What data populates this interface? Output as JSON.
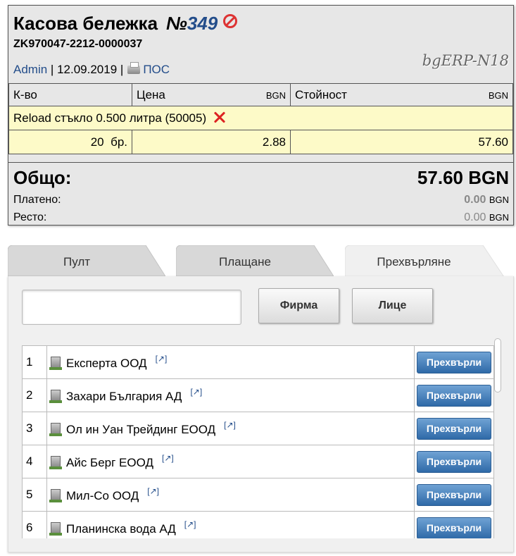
{
  "receipt": {
    "title": "Касова бележка",
    "number_prefix": "№",
    "number": "349",
    "code": "ZK970047-2212-0000037",
    "user": "Admin",
    "separator": "|",
    "date": "12.09.2019",
    "pos_link": "ПОС",
    "brand": "bgERP-N18",
    "columns": {
      "qty": "К-во",
      "price": "Цена",
      "price_currency": "BGN",
      "amount": "Стойност",
      "amount_currency": "BGN"
    },
    "line": {
      "product": "Reload стъкло 0.500 литра (50005)",
      "qty": "20",
      "unit": "бр.",
      "price": "2.88",
      "amount": "57.60"
    },
    "total_label": "Общо:",
    "total_value": "57.60 BGN",
    "paid_label": "Платено:",
    "paid_value": "0.00",
    "paid_currency": "BGN",
    "change_label": "Ресто:",
    "change_value": "0.00",
    "change_currency": "BGN"
  },
  "tabs": [
    {
      "label": "Пулт",
      "active": false
    },
    {
      "label": "Плащане",
      "active": false
    },
    {
      "label": "Прехвърляне",
      "active": true
    }
  ],
  "transfer": {
    "search_value": "",
    "btn_company": "Фирма",
    "btn_person": "Лице",
    "action_label": "Прехвърли",
    "rows": [
      {
        "idx": "1",
        "name": "Експерта ООД"
      },
      {
        "idx": "2",
        "name": "Захари България АД"
      },
      {
        "idx": "3",
        "name": "Ол ин Уан Трейдинг ЕООД"
      },
      {
        "idx": "4",
        "name": "Айс Берг ЕООД"
      },
      {
        "idx": "5",
        "name": "Мил-Со ООД"
      },
      {
        "idx": "6",
        "name": "Планинска вода АД"
      }
    ]
  },
  "colors": {
    "accent": "#234d8a",
    "row_highlight": "#fdfac8",
    "button_blue": "#3b78b8",
    "delete_red": "#d22222"
  }
}
